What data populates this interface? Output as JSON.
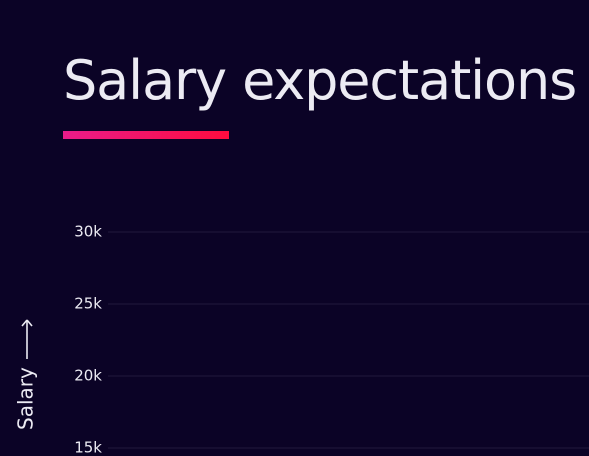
{
  "chart_data": {
    "type": "line",
    "title": "Salary expectations",
    "xlabel": "",
    "ylabel": "Salary",
    "yticks": [
      {
        "value": 30000,
        "label": "30k"
      },
      {
        "value": 25000,
        "label": "25k"
      },
      {
        "value": 20000,
        "label": "20k"
      },
      {
        "value": 15000,
        "label": "15k"
      }
    ],
    "ylim": [
      15000,
      30000
    ],
    "grid": true,
    "series": []
  },
  "colors": {
    "background": "#0b0326",
    "text": "#ecebf3",
    "grid": "#221a3c",
    "accent_start": "#e81c8a",
    "accent_end": "#ff0c3e"
  },
  "icons": {
    "ylabel_arrow": "arrow-up-icon"
  }
}
